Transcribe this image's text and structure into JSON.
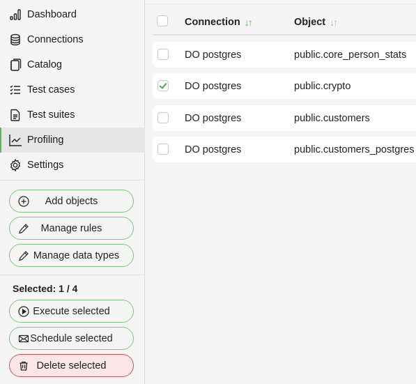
{
  "sidebar": {
    "nav": [
      {
        "label": "Dashboard",
        "icon": "bar-chart-icon",
        "active": false
      },
      {
        "label": "Connections",
        "icon": "database-icon",
        "active": false
      },
      {
        "label": "Catalog",
        "icon": "notebook-icon",
        "active": false
      },
      {
        "label": "Test cases",
        "icon": "checklist-icon",
        "active": false
      },
      {
        "label": "Test suites",
        "icon": "document-icon",
        "active": false
      },
      {
        "label": "Profiling",
        "icon": "line-chart-icon",
        "active": true
      },
      {
        "label": "Settings",
        "icon": "gear-icon",
        "active": false
      }
    ],
    "actions": {
      "add_objects": "Add objects",
      "manage_rules": "Manage rules",
      "manage_data_types": "Manage data types"
    },
    "selected_label": "Selected: 1 / 4",
    "selection_actions": {
      "execute": "Execute selected",
      "schedule": "Schedule selected",
      "delete": "Delete selected"
    }
  },
  "table": {
    "columns": [
      {
        "label": "Connection",
        "sort": "active"
      },
      {
        "label": "Object",
        "sort": "inactive"
      }
    ],
    "rows": [
      {
        "connection": "DO postgres",
        "object": "public.core_person_stats",
        "checked": false
      },
      {
        "connection": "DO postgres",
        "object": "public.crypto",
        "checked": true
      },
      {
        "connection": "DO postgres",
        "object": "public.customers",
        "checked": false
      },
      {
        "connection": "DO postgres",
        "object": "public.customers_postgres",
        "checked": false
      }
    ]
  },
  "colors": {
    "accent": "#5cb85c",
    "danger_border": "#c9555a",
    "danger_bg": "#fae6e7"
  }
}
